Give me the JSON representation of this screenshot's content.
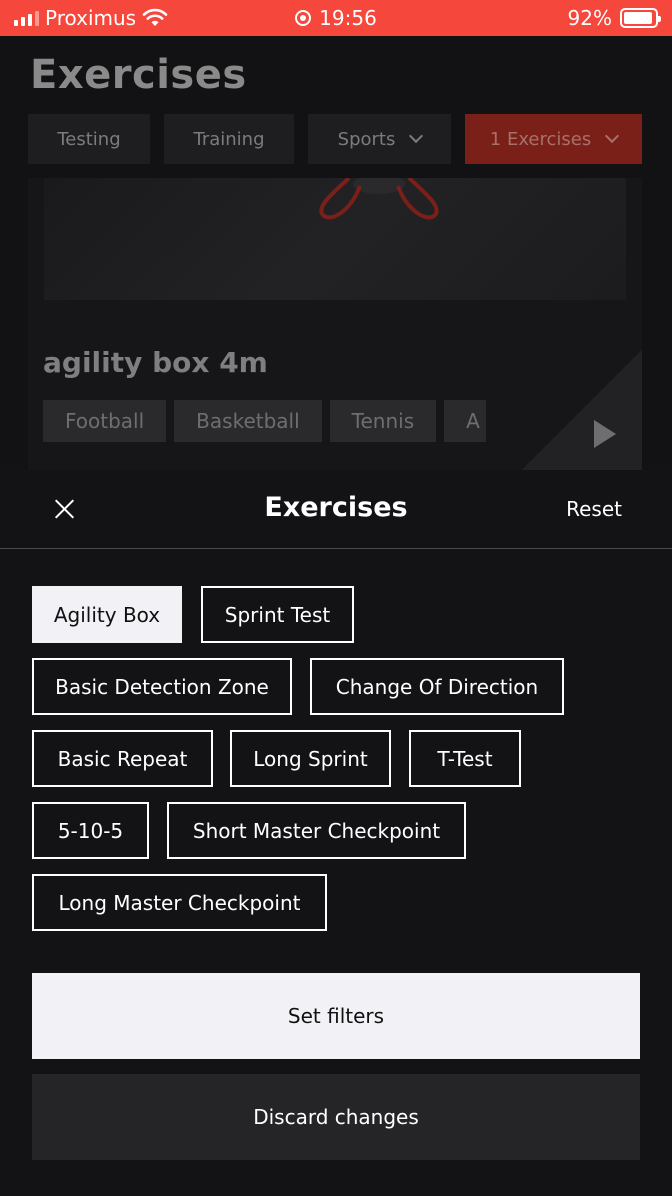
{
  "status_bar": {
    "carrier": "Proximus",
    "time": "19:56",
    "battery": "92%",
    "battery_level": 0.92,
    "icons": [
      "signal-icon",
      "wifi-icon",
      "screen-record-icon",
      "battery-icon"
    ]
  },
  "background_page": {
    "title": "Exercises",
    "filter_tabs": [
      {
        "label": "Testing"
      },
      {
        "label": "Training"
      },
      {
        "label": "Sports"
      },
      {
        "label": "1 Exercises",
        "active": true
      }
    ],
    "card": {
      "title": "agility box 4m",
      "tags": [
        "Football",
        "Basketball",
        "Tennis",
        "A"
      ]
    }
  },
  "sheet": {
    "title": "Exercises",
    "reset_label": "Reset",
    "chips": [
      {
        "label": "Agility Box",
        "selected": true
      },
      {
        "label": "Sprint Test",
        "selected": false
      },
      {
        "label": "Basic Detection Zone",
        "selected": false
      },
      {
        "label": "Change Of Direction",
        "selected": false
      },
      {
        "label": "Basic Repeat",
        "selected": false
      },
      {
        "label": "Long Sprint",
        "selected": false
      },
      {
        "label": "T-Test",
        "selected": false
      },
      {
        "label": "5-10-5",
        "selected": false
      },
      {
        "label": "Short Master Checkpoint",
        "selected": false
      },
      {
        "label": "Long Master Checkpoint",
        "selected": false
      }
    ],
    "primary_button": "Set filters",
    "secondary_button": "Discard changes"
  },
  "colors": {
    "accent": "#f5473b",
    "sheet_bg": "#131315",
    "selected_chip_bg": "#f2f1f6"
  }
}
